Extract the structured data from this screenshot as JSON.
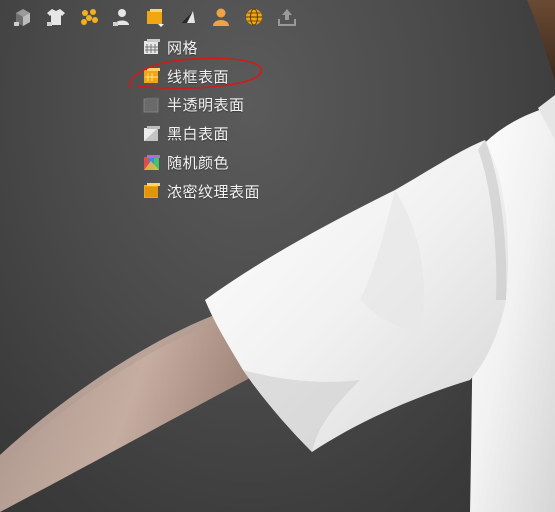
{
  "toolbar": {
    "buttons": [
      {
        "name": "cube-icon"
      },
      {
        "name": "shirt-icon"
      },
      {
        "name": "dots-icon"
      },
      {
        "name": "user-icon"
      },
      {
        "name": "surface-mode-icon"
      },
      {
        "name": "dark-surface-icon"
      },
      {
        "name": "avatar-icon"
      },
      {
        "name": "globe-icon"
      },
      {
        "name": "export-icon"
      }
    ]
  },
  "menu": {
    "items": [
      {
        "label": "网格",
        "icon": "grid-surface-icon"
      },
      {
        "label": "线框表面",
        "icon": "wireframe-surface-icon"
      },
      {
        "label": "半透明表面",
        "icon": "translucent-surface-icon"
      },
      {
        "label": "黑白表面",
        "icon": "bw-surface-icon"
      },
      {
        "label": "随机颜色",
        "icon": "random-color-icon"
      },
      {
        "label": "浓密纹理表面",
        "icon": "dense-texture-surface-icon"
      }
    ],
    "highlighted_index": 1
  },
  "colors": {
    "annotation": "#d11a1a",
    "accent": "#f2a612",
    "text": "#f2f2f2"
  }
}
